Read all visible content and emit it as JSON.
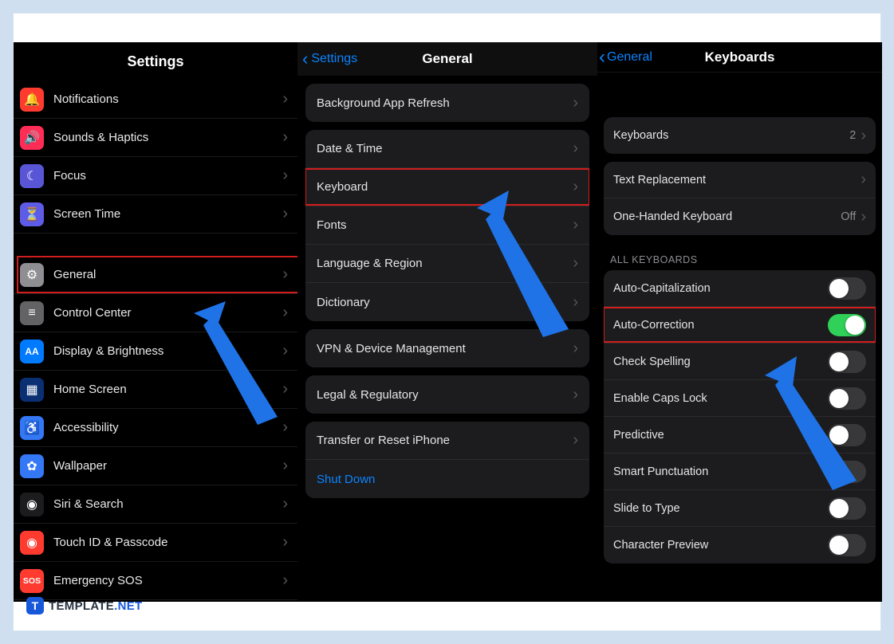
{
  "watermark": {
    "text": "TEMPLATE",
    "suffix": ".NET"
  },
  "panel1": {
    "title": "Settings",
    "group1": [
      {
        "label": "Notifications",
        "icon": "bell-icon",
        "color": "ic-red"
      },
      {
        "label": "Sounds & Haptics",
        "icon": "speaker-icon",
        "color": "ic-pink"
      },
      {
        "label": "Focus",
        "icon": "moon-icon",
        "color": "ic-indigo"
      },
      {
        "label": "Screen Time",
        "icon": "hourglass-icon",
        "color": "ic-purple"
      }
    ],
    "group2": [
      {
        "label": "General",
        "icon": "gear-icon",
        "color": "ic-gray",
        "highlighted": true
      },
      {
        "label": "Control Center",
        "icon": "switches-icon",
        "color": "ic-gray2"
      },
      {
        "label": "Display & Brightness",
        "icon": "text-aa-icon",
        "color": "ic-blue"
      },
      {
        "label": "Home Screen",
        "icon": "grid-icon",
        "color": "ic-bluegrid"
      },
      {
        "label": "Accessibility",
        "icon": "person-icon",
        "color": "ic-cyan"
      },
      {
        "label": "Wallpaper",
        "icon": "flower-icon",
        "color": "ic-cyan"
      },
      {
        "label": "Siri & Search",
        "icon": "siri-icon",
        "color": "ic-dark"
      },
      {
        "label": "Touch ID & Passcode",
        "icon": "fingerprint-icon",
        "color": "ic-red"
      },
      {
        "label": "Emergency SOS",
        "icon": "sos-icon",
        "color": "ic-sos"
      }
    ]
  },
  "panel2": {
    "back_label": "Settings",
    "title": "General",
    "group_top": [
      {
        "label": "Background App Refresh"
      }
    ],
    "group_mid": [
      {
        "label": "Date & Time"
      },
      {
        "label": "Keyboard",
        "highlighted": true
      },
      {
        "label": "Fonts"
      },
      {
        "label": "Language & Region"
      },
      {
        "label": "Dictionary"
      }
    ],
    "group_vpn": [
      {
        "label": "VPN & Device Management"
      }
    ],
    "group_legal": [
      {
        "label": "Legal & Regulatory"
      }
    ],
    "group_reset": [
      {
        "label": "Transfer or Reset iPhone"
      },
      {
        "label": "Shut Down",
        "shutdown": true
      }
    ]
  },
  "panel3": {
    "back_label": "General",
    "title": "Keyboards",
    "group_kb": [
      {
        "label": "Keyboards",
        "value": "2"
      }
    ],
    "group_text": [
      {
        "label": "Text Replacement",
        "chevron": true
      },
      {
        "label": "One-Handed Keyboard",
        "value": "Off"
      }
    ],
    "section_header": "ALL KEYBOARDS",
    "group_toggles": [
      {
        "label": "Auto-Capitalization",
        "on": false
      },
      {
        "label": "Auto-Correction",
        "on": true,
        "highlighted": true
      },
      {
        "label": "Check Spelling",
        "on": false
      },
      {
        "label": "Enable Caps Lock",
        "on": false
      },
      {
        "label": "Predictive",
        "on": false
      },
      {
        "label": "Smart Punctuation",
        "on": false
      },
      {
        "label": "Slide to Type",
        "on": false
      },
      {
        "label": "Character Preview",
        "on": false
      }
    ]
  }
}
